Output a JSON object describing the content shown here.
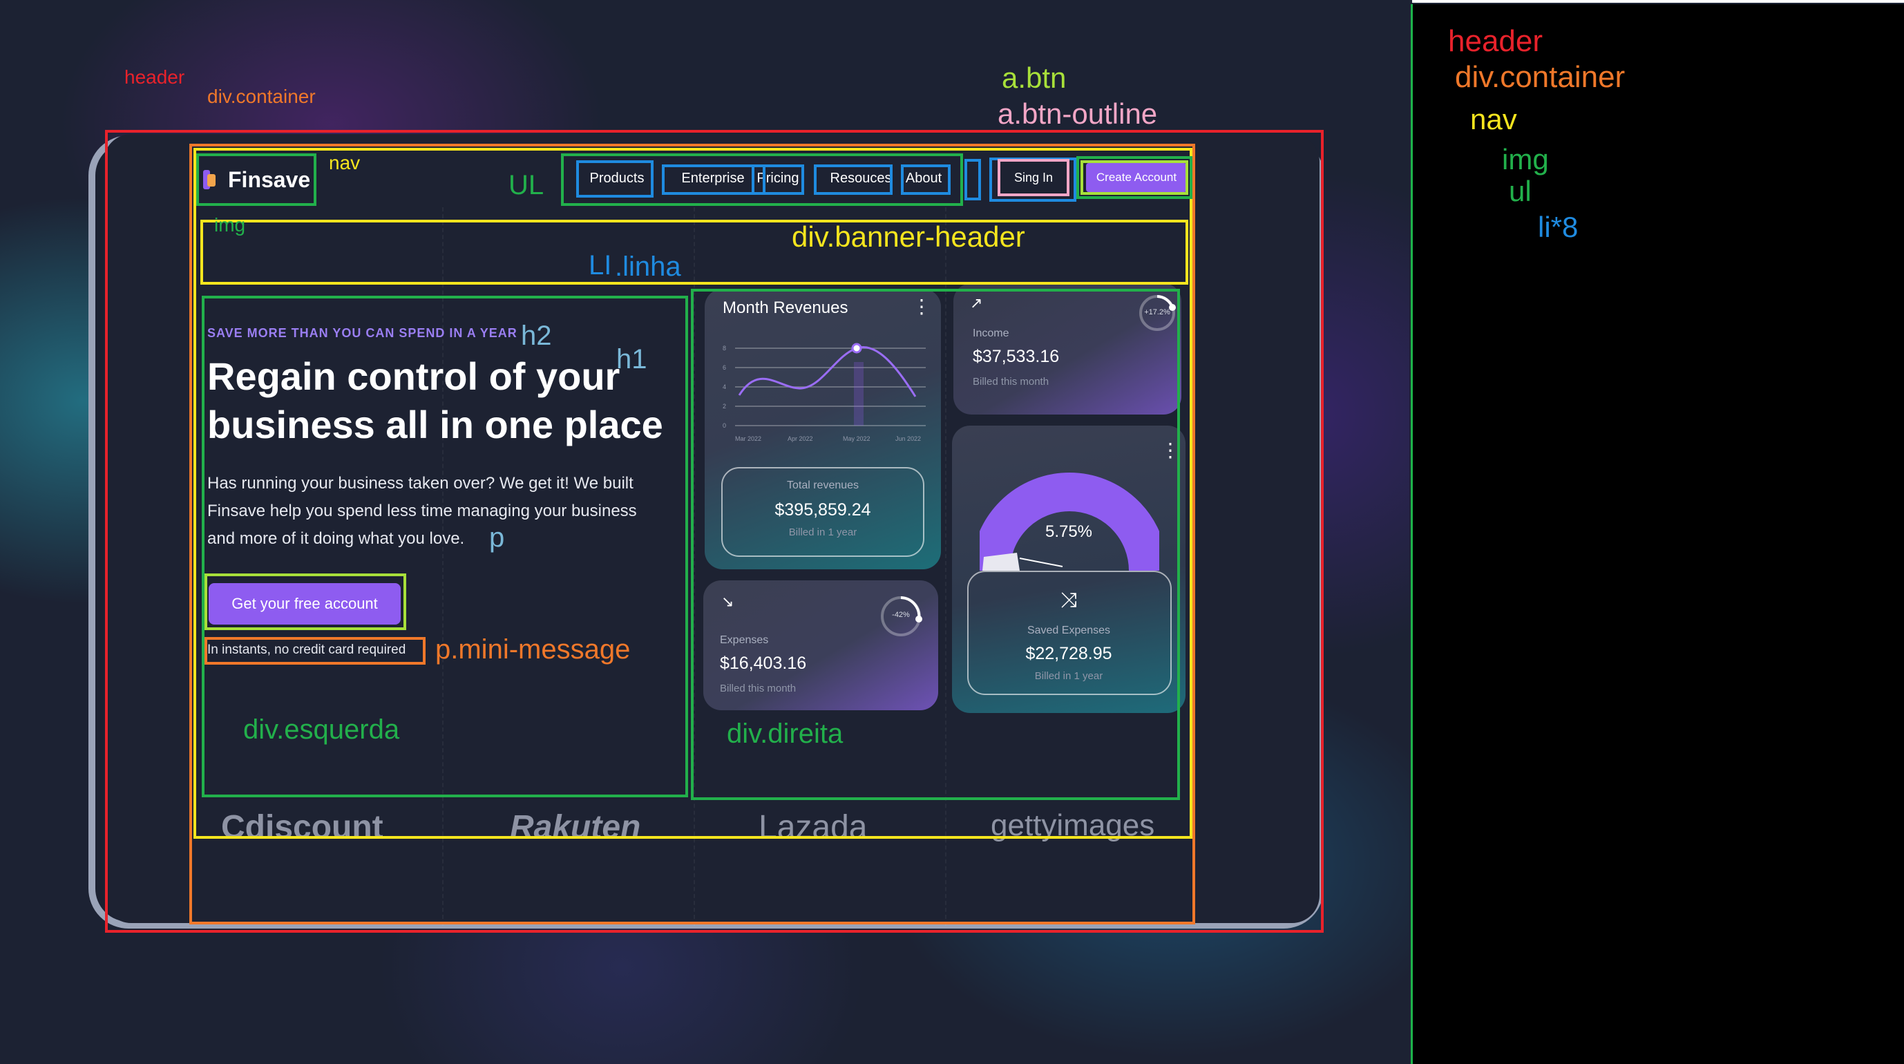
{
  "nav": {
    "logo_text": "Finsave",
    "items": [
      "Products",
      "Enterprise",
      "Pricing",
      "Resouces",
      "About"
    ],
    "sign_in": "Sing In",
    "create_account": "Create Account"
  },
  "hero": {
    "eyebrow": "SAVE MORE THAN YOU CAN SPEND IN A YEAR",
    "headline_line1": "Regain control of your",
    "headline_line2": "business all in one place",
    "intro": "Has running your business taken over? We get it! We built Finsave help you spend less time managing your business and more of it doing what you love.",
    "cta": "Get your free account",
    "mini_message": "In instants, no credit card required"
  },
  "cards": {
    "revenues": {
      "title": "Month Revenues",
      "y_ticks": [
        "8",
        "6",
        "4",
        "2",
        "0"
      ],
      "x_ticks": [
        "Mar 2022",
        "Apr 2022",
        "May 2022",
        "Jun 2022"
      ],
      "total_label": "Total revenues",
      "total_value": "$395,859.24",
      "total_foot": "Billed in 1 year"
    },
    "income": {
      "label": "Income",
      "value": "$37,533.16",
      "foot": "Billed this month",
      "badge": "+17.2%"
    },
    "gauge": {
      "percent_text": "5.75%",
      "saved_label": "Saved Expenses",
      "saved_value": "$22,728.95",
      "saved_foot": "Billed in 1 year"
    },
    "expenses": {
      "label": "Expenses",
      "value": "$16,403.16",
      "foot": "Billed this month",
      "badge": "-42%"
    }
  },
  "brands": [
    "Cdiscount",
    "Rakuten",
    "Lazada",
    "gettyimages"
  ],
  "annotations": {
    "header": "header",
    "div_container": "div.container",
    "nav": "nav",
    "img": "img",
    "ul": "UL",
    "a_btn": "a.btn",
    "a_btn_outline": "a.btn-outline",
    "banner_header": "div.banner-header",
    "li_linha": "LI",
    "linha": ".linha",
    "h2": "h2",
    "h1": "h1",
    "p": "p",
    "mini_message": "p.mini-message",
    "esquerda": "div.esquerda",
    "direita": "div.direita"
  },
  "outline": {
    "header": "header",
    "div_container": "div.container",
    "nav": "nav",
    "img": "img",
    "ul": "ul",
    "li": "li*8"
  },
  "colors": {
    "accent": "#8e5cf0",
    "annotation_red": "#e8222b",
    "annotation_orange": "#f0782a",
    "annotation_yellow": "#f6e51e",
    "annotation_green": "#22b04b",
    "annotation_blue": "#1f8be0",
    "annotation_pink": "#f2a6c6",
    "annotation_lime": "#a8e03a"
  }
}
